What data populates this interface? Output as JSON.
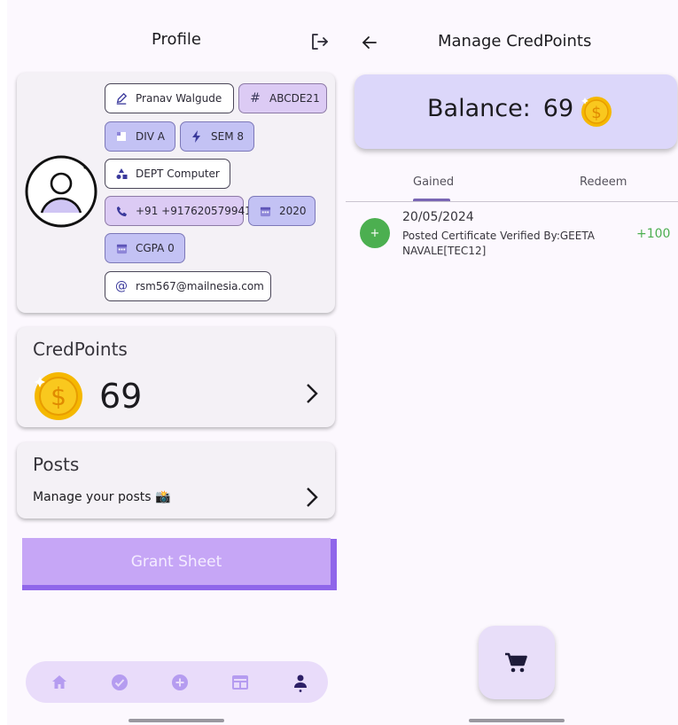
{
  "left_screen": {
    "header": {
      "title": "Profile",
      "logout_icon": "logout-icon"
    },
    "profile": {
      "avatar_icon": "person-circle-icon",
      "chips": {
        "name": {
          "label": "Pranav Walgude",
          "icon": "edit-pen-icon"
        },
        "id": {
          "label": "ABCDE21",
          "icon": "hash-icon"
        },
        "division": {
          "label": "DIV A",
          "icon": "division-square-icon"
        },
        "semester": {
          "label": "SEM 8",
          "icon": "bolt-icon"
        },
        "department": {
          "label": "DEPT Computer",
          "icon": "category-shapes-icon"
        },
        "phone": {
          "label": "+91 +917620579941",
          "icon": "phone-icon"
        },
        "year": {
          "label": "2020",
          "icon": "calendar-icon"
        },
        "cgpa": {
          "label": "CGPA 0",
          "icon": "calendar-icon"
        },
        "email": {
          "label": "rsm567@mailnesia.com",
          "icon": "at-sign-icon"
        }
      }
    },
    "credpoints": {
      "title": "CredPoints",
      "value": "69",
      "icon": "gold-coin-icon"
    },
    "posts": {
      "title": "Posts",
      "subtitle": "Manage your posts 📸"
    },
    "grant_button": {
      "label": "Grant Sheet"
    },
    "bottom_nav": {
      "items": [
        "home-icon",
        "check-circle-icon",
        "add-circle-icon",
        "dashboard-icon",
        "person-icon"
      ],
      "active": "person-icon"
    }
  },
  "right_screen": {
    "header": {
      "title": "Manage CredPoints",
      "back_icon": "arrow-back-icon"
    },
    "balance": {
      "label": "Balance:",
      "value": "69",
      "icon": "gold-coin-icon"
    },
    "tabs": {
      "gained": "Gained",
      "redeem": "Redeem",
      "selected": "Gained"
    },
    "transactions": [
      {
        "icon_label": "+",
        "date": "20/05/2024",
        "description": "Posted Certificate Verified By:GEETA NAVALE[TEC12]",
        "amount": "+100"
      }
    ],
    "fab": {
      "icon": "shopping-cart-icon"
    }
  },
  "colors": {
    "background": "#fcf8fe",
    "chip_purple": "#dccbf4",
    "chip_blue": "#c3c2f4",
    "grant_button": "#c6a6f6",
    "grant_button_shadow": "#8f66ea",
    "balance_card": "#dcd7fa",
    "nav_bar": "#e9dcfa",
    "nav_icon": "#b59cf0",
    "nav_icon_active": "#2d1f66",
    "gain_green": "#4caf50",
    "coin_gold": "#f5b800"
  }
}
